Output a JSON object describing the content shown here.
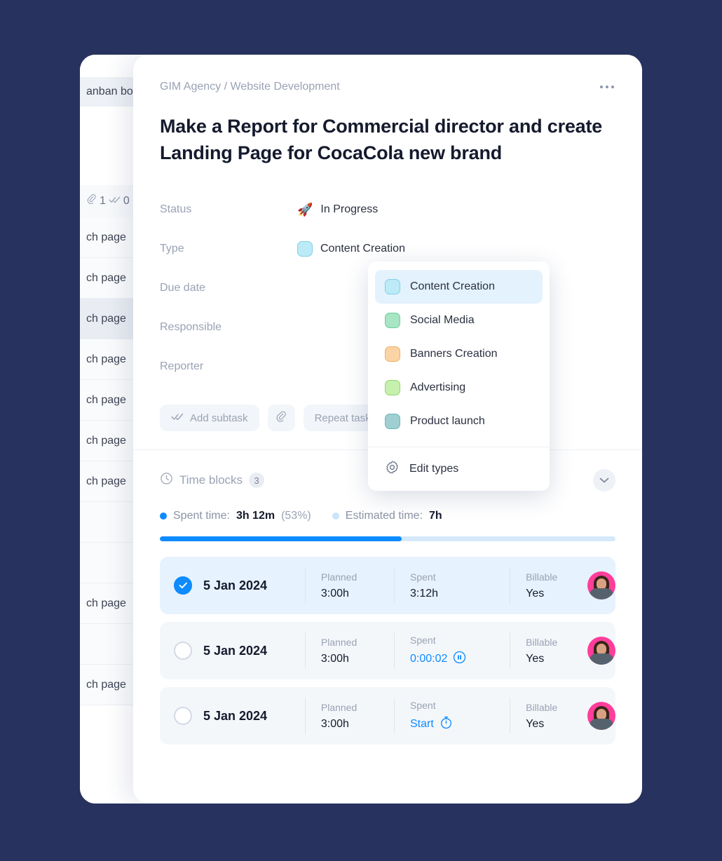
{
  "board": {
    "header_title": "anban boa",
    "close_icon": "close-icon",
    "attachment_count": "1",
    "subtask_count": "0",
    "rows": [
      {
        "label": "ch page",
        "highlight": false
      },
      {
        "label": "ch page",
        "highlight": false
      },
      {
        "label": "ch page",
        "highlight": true
      },
      {
        "label": "ch page",
        "highlight": false
      },
      {
        "label": "ch page",
        "highlight": false
      },
      {
        "label": "ch page",
        "highlight": false
      },
      {
        "label": "ch page",
        "highlight": false
      },
      {
        "label": "",
        "highlight": false
      },
      {
        "label": "",
        "highlight": false
      },
      {
        "label": "ch page",
        "highlight": false
      },
      {
        "label": "",
        "highlight": false
      },
      {
        "label": "ch page",
        "highlight": false
      }
    ]
  },
  "modal": {
    "breadcrumb": "GIM Agency / Website Development",
    "more_icon": "ellipsis-icon",
    "title": "Make a Report for Commercial director and create Landing Page for CocaCola new brand",
    "fields": [
      {
        "label": "Status",
        "emoji": "🚀",
        "value": "In Progress"
      },
      {
        "label": "Type",
        "swatch": "#bdeaf7",
        "value": "Content Creation"
      },
      {
        "label": "Due date",
        "value": ""
      },
      {
        "label": "Responsible",
        "value": ""
      },
      {
        "label": "Reporter",
        "value": ""
      }
    ],
    "actions": [
      {
        "label": "Add subtask",
        "icon": "double-check-icon"
      },
      {
        "label": "",
        "icon": "paperclip-icon"
      },
      {
        "label": "Repeat task",
        "icon": "repeat-icon"
      }
    ]
  },
  "type_dropdown": {
    "options": [
      {
        "label": "Content Creation",
        "color": "#bdeaf7",
        "selected": true
      },
      {
        "label": "Social Media",
        "color": "#a7e5c4",
        "selected": false
      },
      {
        "label": "Banners Creation",
        "color": "#fbd4a5",
        "selected": false
      },
      {
        "label": "Advertising",
        "color": "#c6f0ae",
        "selected": false
      },
      {
        "label": "Product launch",
        "color": "#9fcfd2",
        "selected": false
      }
    ],
    "footer": {
      "label": "Edit types",
      "icon": "gear-icon"
    }
  },
  "time_blocks": {
    "title": "Time blocks",
    "count": "3",
    "clock_icon": "clock-icon",
    "collapse_icon": "chevron-down-icon",
    "legend": {
      "spent_label": "Spent time:",
      "spent_value": "3h 12m",
      "spent_percent": "(53%)",
      "spent_color": "#0d8bff",
      "estimated_label": "Estimated time:",
      "estimated_value": "7h",
      "estimated_color": "#c9e4fb"
    },
    "progress_percent": 53,
    "column_labels": {
      "planned": "Planned",
      "spent": "Spent",
      "billable": "Billable"
    },
    "rows": [
      {
        "date": "5 Jan 2024",
        "completed": true,
        "planned": "3:00h",
        "spent": "3:12h",
        "spent_state": "static",
        "billable": "Yes"
      },
      {
        "date": "5 Jan 2024",
        "completed": false,
        "planned": "3:00h",
        "spent": "0:00:02",
        "spent_state": "running",
        "spent_icon": "pause-icon",
        "billable": "Yes"
      },
      {
        "date": "5 Jan 2024",
        "completed": false,
        "planned": "3:00h",
        "spent": "Start",
        "spent_state": "idle",
        "spent_icon": "stopwatch-icon",
        "billable": "Yes"
      }
    ]
  },
  "colors": {
    "page_background": "#27325e",
    "accent": "#0d8bff",
    "selected_row": "#e6f2fd",
    "avatar_background": "#ff3d9a"
  }
}
